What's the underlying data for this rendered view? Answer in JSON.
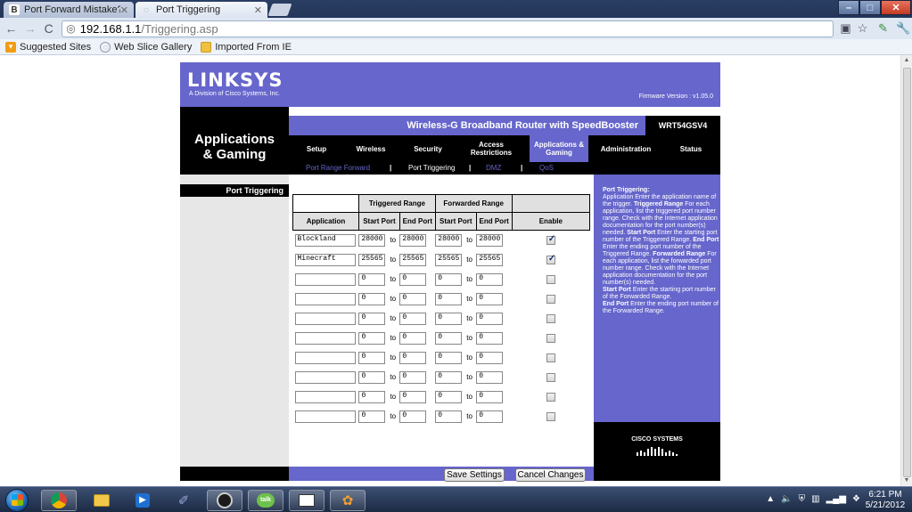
{
  "browser": {
    "tabs": [
      {
        "label": "Port Forward Mistake?",
        "active": false
      },
      {
        "label": "Port Triggering",
        "active": true
      }
    ],
    "url_host": "192.168.1.1",
    "url_path": "/Triggering.asp",
    "bookmarks": [
      "Suggested Sites",
      "Web Slice Gallery",
      "Imported From IE"
    ]
  },
  "router": {
    "logo": "LINKSYS",
    "logo_sub": "A Division of Cisco Systems, Inc.",
    "firmware": "Firmware Version : v1.05.0",
    "section_title_line1": "Applications",
    "section_title_line2": "& Gaming",
    "model_name": "Wireless-G Broadband Router with SpeedBooster",
    "model_num": "WRT54GSV4",
    "nav": [
      {
        "label": "Setup"
      },
      {
        "label": "Wireless"
      },
      {
        "label": "Security"
      },
      {
        "label": "Access Restrictions"
      },
      {
        "label": "Applications & Gaming",
        "active": true
      },
      {
        "label": "Administration"
      },
      {
        "label": "Status"
      }
    ],
    "subnav": [
      {
        "label": "Port Range Forward"
      },
      {
        "label": "Port Triggering",
        "active": true
      },
      {
        "label": "DMZ"
      },
      {
        "label": "QoS"
      }
    ],
    "subnav_sep": "|",
    "left_label": "Port Triggering",
    "table": {
      "group_triggered": "Triggered Range",
      "group_forwarded": "Forwarded Range",
      "col_application": "Application",
      "col_start": "Start Port",
      "col_end": "End Port",
      "col_enable": "Enable",
      "to_label": "to",
      "rows": [
        {
          "app": "Blockland",
          "t_start": "28000",
          "t_end": "28000",
          "f_start": "28000",
          "f_end": "28000",
          "enabled": true
        },
        {
          "app": "Minecraft",
          "t_start": "25565",
          "t_end": "25565",
          "f_start": "25565",
          "f_end": "25565",
          "enabled": true
        },
        {
          "app": "",
          "t_start": "0",
          "t_end": "0",
          "f_start": "0",
          "f_end": "0",
          "enabled": false
        },
        {
          "app": "",
          "t_start": "0",
          "t_end": "0",
          "f_start": "0",
          "f_end": "0",
          "enabled": false
        },
        {
          "app": "",
          "t_start": "0",
          "t_end": "0",
          "f_start": "0",
          "f_end": "0",
          "enabled": false
        },
        {
          "app": "",
          "t_start": "0",
          "t_end": "0",
          "f_start": "0",
          "f_end": "0",
          "enabled": false
        },
        {
          "app": "",
          "t_start": "0",
          "t_end": "0",
          "f_start": "0",
          "f_end": "0",
          "enabled": false
        },
        {
          "app": "",
          "t_start": "0",
          "t_end": "0",
          "f_start": "0",
          "f_end": "0",
          "enabled": false
        },
        {
          "app": "",
          "t_start": "0",
          "t_end": "0",
          "f_start": "0",
          "f_end": "0",
          "enabled": false
        },
        {
          "app": "",
          "t_start": "0",
          "t_end": "0",
          "f_start": "0",
          "f_end": "0",
          "enabled": false
        }
      ]
    },
    "help": {
      "title": "Port Triggering:",
      "p1": "Application Enter the application name of the trigger.",
      "k1": "Triggered Range",
      "p2": "For each application, list the triggered port number range. Check with the Internet application documentation for the port number(s) needed.",
      "k2": "Start Port",
      "p3": "Enter the starting port number of the Triggered Range.",
      "k3": "End Port",
      "p4": "Enter the ending port number of the Triggered Range.",
      "k4": "Forwarded Range",
      "p5": "For each application, list the forwarded port number range. Check with the Internet application documentation for the port number(s) needed.",
      "k5": "Start Port",
      "p6": "Enter the starting port number of the Forwarded Range.",
      "k6": "End Port",
      "p7": "Enter the ending port number of the Forwarded Range."
    },
    "cisco": "CISCO SYSTEMS",
    "save_label": "Save Settings",
    "cancel_label": "Cancel Changes"
  },
  "taskbar": {
    "time": "6:21 PM",
    "date": "5/21/2012"
  }
}
